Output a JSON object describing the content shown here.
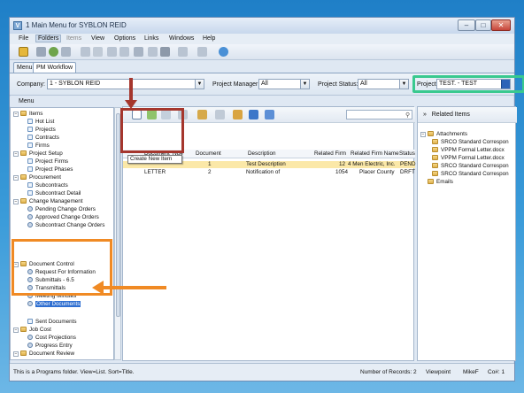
{
  "window": {
    "title": "1 Main Menu for SYBLON REID",
    "app_icon": "V"
  },
  "menubar": [
    "File",
    "Folders",
    "Items",
    "View",
    "Options",
    "Links",
    "Windows",
    "Help"
  ],
  "tabs": [
    "Menu",
    "PM Workflow"
  ],
  "filters": {
    "company_label": "Company:",
    "company_value": "1 - SYBLON REID",
    "manager_label": "Project Manager:",
    "manager_value": "All",
    "status_label": "Project Status:",
    "status_value": "All",
    "project_label": "Project:",
    "project_value": "TEST. - TEST"
  },
  "menu_header": "Menu",
  "tree": {
    "items": "Items",
    "hot_list": "Hot List",
    "projects": "Projects",
    "contracts": "Contracts",
    "firms": "Firms",
    "project_setup": "Project Setup",
    "project_firms": "Project Firms",
    "project_phases": "Project Phases",
    "procurement": "Procurement",
    "subcontracts": "Subcontracts",
    "subcontract_detail": "Subcontract Detail",
    "change_mgmt": "Change Management",
    "pending_co": "Pending Change Orders",
    "approved_co": "Approved Change Orders",
    "sub_co": "Subcontract Change Orders",
    "doc_control": "Document Control",
    "rfi": "Request For Information",
    "submittals": "Submittals - 6.5",
    "transmittals": "Transmittals",
    "minutes": "Meeting Minutes",
    "other_docs": "Other Documents",
    "sent_docs": "Sent Documents",
    "job_cost": "Job Cost",
    "cost_proj": "Cost Projections",
    "progress": "Progress Entry",
    "doc_review": "Document Review"
  },
  "grid": {
    "tooltip": "Create New Item",
    "headers": {
      "type": "Document Type",
      "document": "Document",
      "description": "Description",
      "related_firm": "Related Firm",
      "related_firm_name": "Related Firm Name",
      "status": "Status"
    },
    "rows": [
      {
        "type": "",
        "document": "1",
        "description": "Test Description",
        "related_firm": "12",
        "related_firm_name": "4 Men Electric, Inc.",
        "status": "PEND"
      },
      {
        "type": "LETTER",
        "document": "2",
        "description": "Notification of",
        "related_firm": "1054",
        "related_firm_name": "Placer County",
        "status": "DRFT"
      }
    ]
  },
  "related": {
    "header": "Related Items",
    "attachments": "Attachments",
    "files": [
      "SRCO Standard Correspon",
      "VPPM Formal Letter.docx",
      "VPPM Formal Letter.docx",
      "SRCO Standard Correspon",
      "SRCO Standard Correspon"
    ],
    "emails": "Emails"
  },
  "status": {
    "left": "This is a Programs folder. View=List. Sort=Title.",
    "records": "Number of Records: 2",
    "viewpoint": "Viewpoint",
    "user": "MikeF",
    "co": "Co#: 1"
  },
  "colors": {
    "red_annotation": "#a5362d",
    "orange_annotation": "#f08a24",
    "green_annotation": "#39c98f",
    "selected_row": "#fbe8a8"
  }
}
